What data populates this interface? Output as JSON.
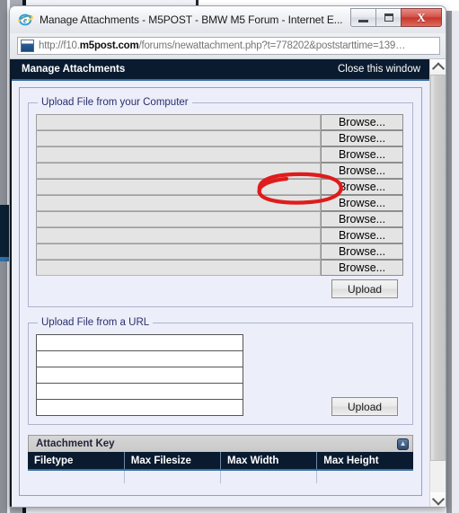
{
  "window": {
    "title": "Manage Attachments - M5POST - BMW M5 Forum - Internet E...",
    "app_icon": "internet-explorer-icon",
    "controls": {
      "minimize_label": "–",
      "maximize_label": "❐",
      "close_label": "X"
    }
  },
  "address_bar": {
    "url_prefix": "http://f10.",
    "url_domain": "m5post.com",
    "url_suffix": "/forums/newattachment.php?t=778202&poststarttime=139…",
    "page_icon": "page-document-icon"
  },
  "page_header": {
    "title": "Manage Attachments",
    "close_link": "Close this window"
  },
  "upload_computer": {
    "legend": "Upload File from your Computer",
    "rows": [
      {
        "value": "",
        "browse_label": "Browse..."
      },
      {
        "value": "",
        "browse_label": "Browse..."
      },
      {
        "value": "",
        "browse_label": "Browse..."
      },
      {
        "value": "",
        "browse_label": "Browse..."
      },
      {
        "value": "",
        "browse_label": "Browse..."
      },
      {
        "value": "",
        "browse_label": "Browse..."
      },
      {
        "value": "",
        "browse_label": "Browse..."
      },
      {
        "value": "",
        "browse_label": "Browse..."
      },
      {
        "value": "",
        "browse_label": "Browse..."
      },
      {
        "value": "",
        "browse_label": "Browse..."
      }
    ],
    "upload_label": "Upload"
  },
  "upload_url": {
    "legend": "Upload File from a URL",
    "rows": [
      {
        "value": "",
        "placeholder": ""
      },
      {
        "value": "",
        "placeholder": ""
      },
      {
        "value": "",
        "placeholder": ""
      },
      {
        "value": "",
        "placeholder": ""
      },
      {
        "value": "",
        "placeholder": ""
      }
    ],
    "upload_label": "Upload"
  },
  "attachment_key": {
    "title": "Attachment Key",
    "collapse_icon": "collapse-arrows-icon",
    "columns": [
      "Filetype",
      "Max Filesize",
      "Max Width",
      "Max Height"
    ]
  },
  "scrollbar": {
    "up_icon": "chevron-up-icon",
    "down_icon": "chevron-down-icon"
  },
  "annotation": {
    "type": "hand-drawn-red-ellipse",
    "target": "first-browse-button",
    "color": "#e01b1b"
  },
  "colors": {
    "header_navy": "#0a1b30",
    "header_underline": "#3a6fa5",
    "page_bg": "#eceefa",
    "legend_text": "#2b2f6b",
    "annotation_red": "#e01b1b"
  }
}
